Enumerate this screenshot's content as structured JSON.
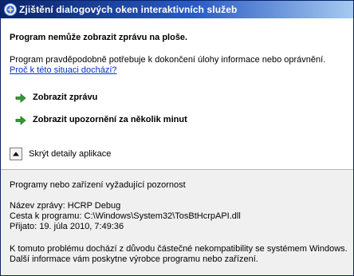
{
  "window": {
    "title": "Zjištění dialogových oken interaktivních služeb"
  },
  "message": {
    "headline": "Program nemůže zobrazit zprávu na ploše.",
    "description": "Program pravděpodobně potřebuje k dokončení úlohy informace nebo oprávnění.",
    "why_link": "Proč k této situaci dochází?"
  },
  "actions": [
    {
      "label": "Zobrazit zprávu",
      "icon": "green-arrow-icon"
    },
    {
      "label": "Zobrazit upozornění za několik minut",
      "icon": "green-arrow-icon"
    }
  ],
  "details_toggle": {
    "label": "Skrýt detaily aplikace",
    "icon": "collapse-up-arrow-icon"
  },
  "details": {
    "heading": "Programy nebo zařízení vyžadující pozornost",
    "message_name_label": "Název zprávy:",
    "message_name_value": "HCRP Debug",
    "program_path_label": "Cesta k programu:",
    "program_path_value": "C:\\Windows\\System32\\TosBtHcrpAPI.dll",
    "received_label": "Přijato:",
    "received_value": "19. júla 2010, 7:49:36",
    "note_line1": "K tomuto problému dochází z důvodu částečné nekompatibility se systémem Windows.",
    "note_line2": "Další informace vám poskytne výrobce programu nebo zařízení."
  },
  "colors": {
    "titlebar_start": "#0a246a",
    "titlebar_end": "#a6caf0",
    "link": "#0033cc",
    "arrow_green": "#2f9e2f",
    "details_background": "#f0f0f0"
  }
}
